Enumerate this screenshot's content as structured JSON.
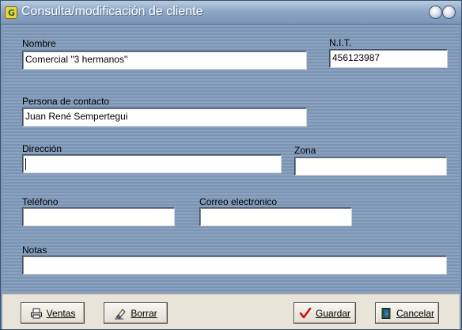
{
  "window": {
    "title": "Consulta/modificación de cliente"
  },
  "form": {
    "nombre": {
      "label": "Nombre",
      "value": "Comercial \"3 hermanos\""
    },
    "nit": {
      "label": "N.I.T.",
      "value": "456123987"
    },
    "contacto": {
      "label": "Persona de contacto",
      "value": "Juan René Sempertegui"
    },
    "direccion": {
      "label": "Dirección",
      "value": ""
    },
    "zona": {
      "label": "Zona",
      "value": ""
    },
    "telefono": {
      "label": "Teléfono",
      "value": ""
    },
    "correo": {
      "label": "Correo electronico",
      "value": ""
    },
    "notas": {
      "label": "Notas",
      "value": ""
    }
  },
  "buttons": {
    "ventas": "Ventas",
    "borrar": "Borrar",
    "guardar": "Guardar",
    "cancelar": "Cancelar"
  },
  "icons": {
    "app": "app-icon",
    "ventas": "printer-icon",
    "borrar": "eraser-icon",
    "guardar": "checkmark-icon",
    "cancelar": "door-exit-icon"
  },
  "colors": {
    "form_background": "#7f97b6",
    "footer_background": "#e8e5d8",
    "checkmark": "#d01010"
  }
}
